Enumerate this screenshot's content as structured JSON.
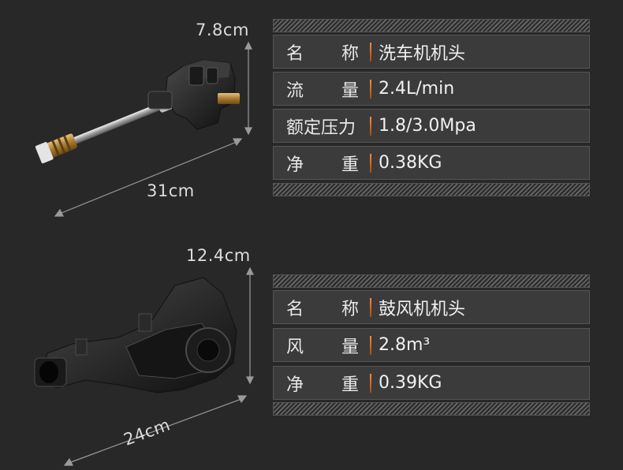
{
  "product1": {
    "height_dim": "7.8cm",
    "length_dim": "31cm",
    "specs": [
      {
        "label_a": "名",
        "label_b": "称",
        "value": "洗车机机头"
      },
      {
        "label_a": "流",
        "label_b": "量",
        "value": "2.4L/min"
      },
      {
        "label_full": "额定压力",
        "value": "1.8/3.0Mpa"
      },
      {
        "label_a": "净",
        "label_b": "重",
        "value": "0.38KG"
      }
    ]
  },
  "product2": {
    "height_dim": "12.4cm",
    "length_dim": "24cm",
    "specs": [
      {
        "label_a": "名",
        "label_b": "称",
        "value": "鼓风机机头"
      },
      {
        "label_a": "风",
        "label_b": "量",
        "value": "2.8m³"
      },
      {
        "label_a": "净",
        "label_b": "重",
        "value": "0.39KG"
      }
    ]
  },
  "colors": {
    "background": "#282828",
    "row_bg": "#3b3b3b",
    "accent_bar": "#ff8a3a"
  }
}
